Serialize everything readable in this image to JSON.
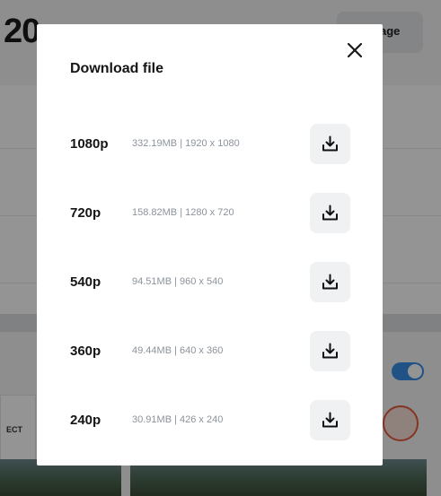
{
  "background": {
    "title": "20",
    "page_button": "age",
    "card_text": "ECT"
  },
  "modal": {
    "title": "Download file",
    "options": [
      {
        "resolution": "1080p",
        "size": "332.19MB",
        "dimensions": "1920 x 1080"
      },
      {
        "resolution": "720p",
        "size": "158.82MB",
        "dimensions": "1280 x 720"
      },
      {
        "resolution": "540p",
        "size": "94.51MB",
        "dimensions": "960 x 540"
      },
      {
        "resolution": "360p",
        "size": "49.44MB",
        "dimensions": "640 x 360"
      },
      {
        "resolution": "240p",
        "size": "30.91MB",
        "dimensions": "426 x 240"
      }
    ]
  },
  "icons": {
    "close": "close-icon",
    "download": "download-icon"
  },
  "colors": {
    "toggle": "#3a8ee6",
    "overlay": "rgba(0,0,0,0.42)",
    "button_bg": "#f0f1f2"
  }
}
